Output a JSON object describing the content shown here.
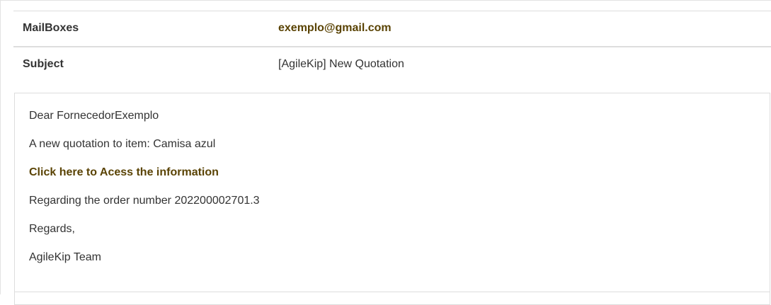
{
  "mail": {
    "mailboxes_label": "MailBoxes",
    "mailboxes_value": "exemplo@gmail.com",
    "subject_label": "Subject",
    "subject_value": "[AgileKip] New Quotation"
  },
  "message": {
    "greeting": "Dear FornecedorExemplo",
    "line1": "A new quotation to item: Camisa azul",
    "link_text": "Click here to Acess the information",
    "order_line": "Regarding the order number 202200002701.3",
    "regards": "Regards,",
    "signature": "AgileKip Team"
  },
  "colors": {
    "accent": "#5a4304",
    "text": "#333333",
    "border": "#dddddd"
  }
}
